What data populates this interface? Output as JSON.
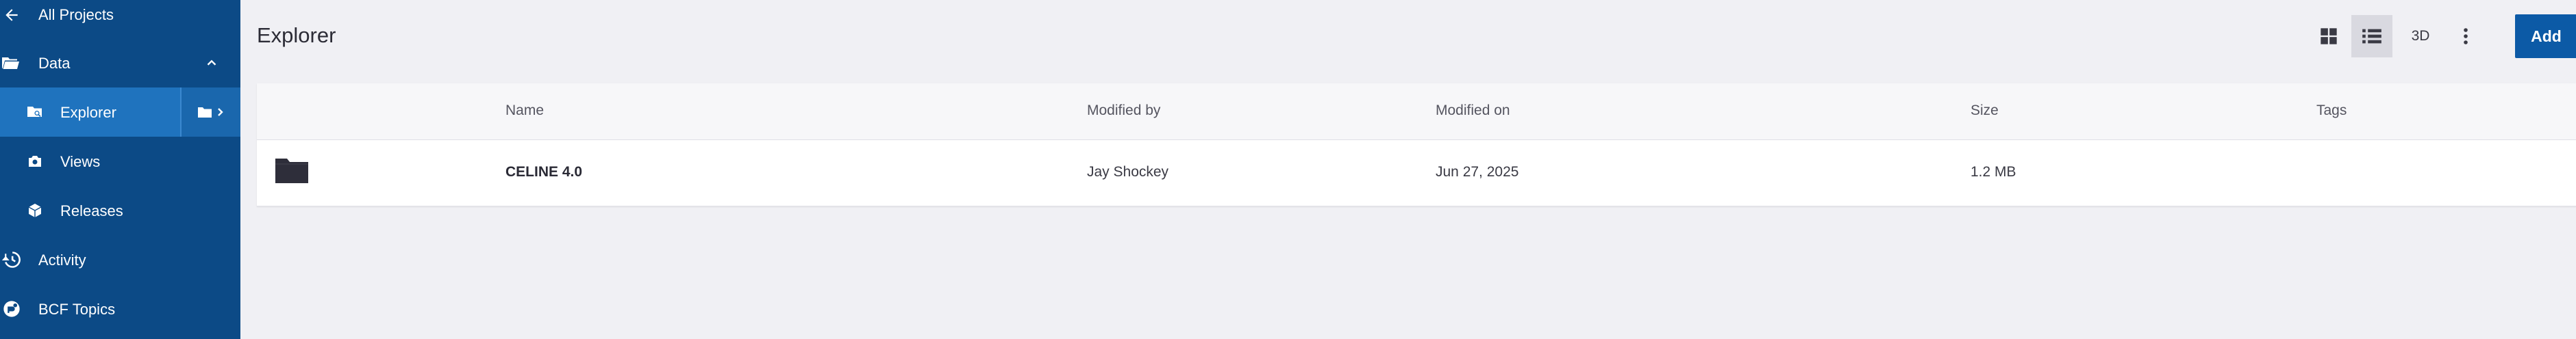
{
  "colors": {
    "sidebar_bg": "#0c4a86",
    "sidebar_active": "#1f73be",
    "accent": "#0c5aa6",
    "page_bg": "#f0f0f4"
  },
  "sidebar": {
    "back": {
      "label": "All Projects",
      "icon": "arrow-left-icon"
    },
    "section": {
      "label": "Data",
      "icon": "folder-open-icon",
      "expand_icon": "chevron-up-icon",
      "expanded": true
    },
    "items": [
      {
        "label": "Explorer",
        "icon": "folder-search-icon",
        "active": true
      },
      {
        "label": "Views",
        "icon": "camera-icon",
        "active": false
      },
      {
        "label": "Releases",
        "icon": "cube-icon",
        "active": false
      }
    ],
    "bottom": [
      {
        "label": "Activity",
        "icon": "history-icon"
      },
      {
        "label": "BCF Topics",
        "icon": "bcf-topics-icon"
      }
    ]
  },
  "header": {
    "title": "Explorer",
    "view_buttons": [
      {
        "icon": "grid-view-icon",
        "selected": false
      },
      {
        "icon": "list-view-icon",
        "selected": true
      },
      {
        "label": "3D",
        "selected": false
      }
    ],
    "more_icon": "more-vertical-icon",
    "add_label": "Add"
  },
  "table": {
    "columns": [
      "Name",
      "Modified by",
      "Modified on",
      "Size",
      "Tags"
    ],
    "rows": [
      {
        "icon": "folder-icon",
        "name": "CELINE 4.0",
        "modified_by": "Jay Shockey",
        "modified_on": "Jun 27, 2025",
        "size": "1.2 MB",
        "tags": ""
      }
    ]
  }
}
